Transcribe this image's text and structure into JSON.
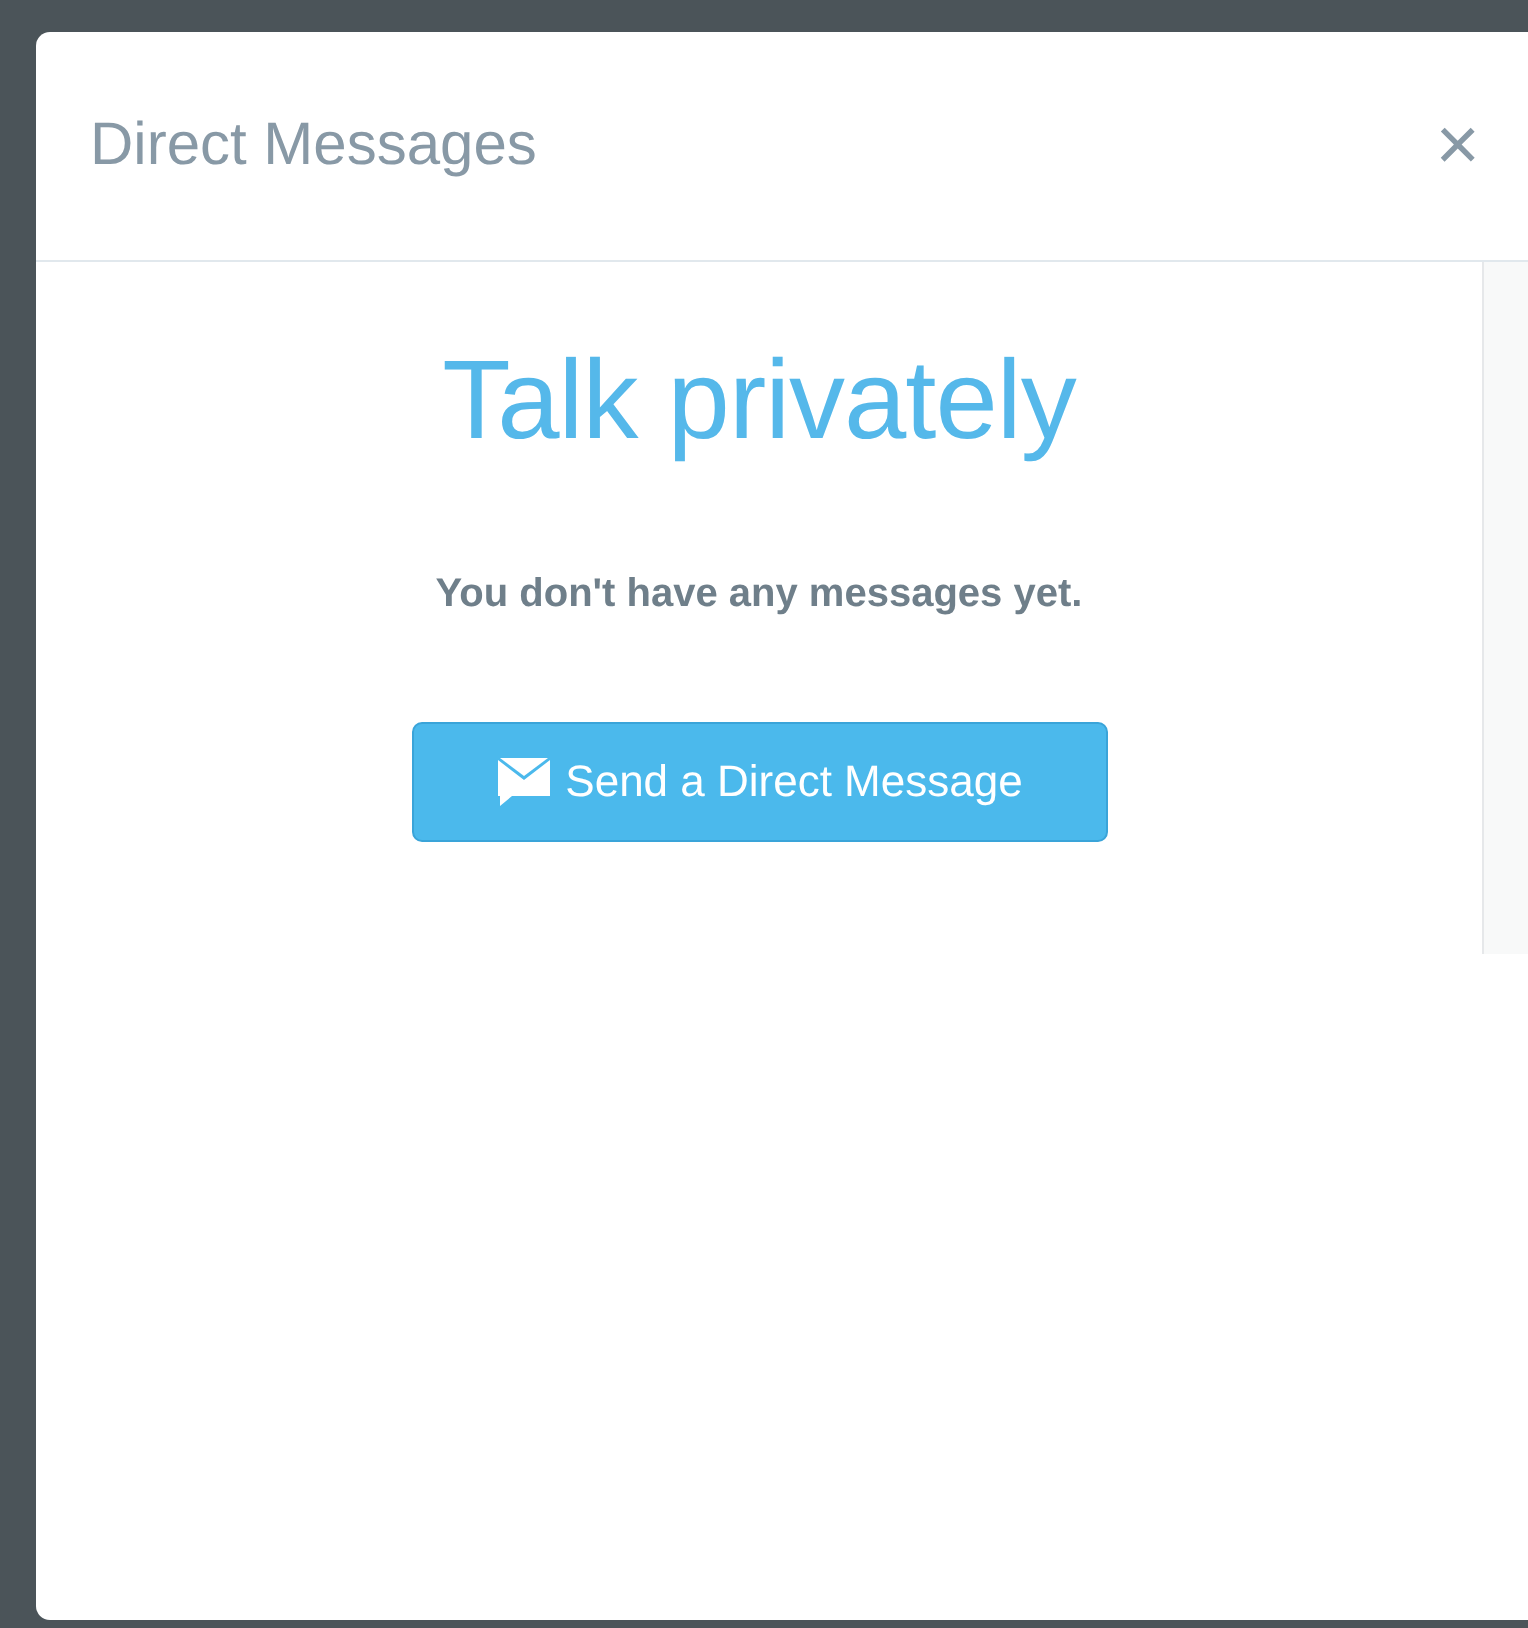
{
  "dialog": {
    "title": "Direct Messages",
    "close": "×"
  },
  "empty_state": {
    "heading": "Talk privately",
    "message": "You don't have any messages yet.",
    "button": "Send a Direct Message"
  }
}
